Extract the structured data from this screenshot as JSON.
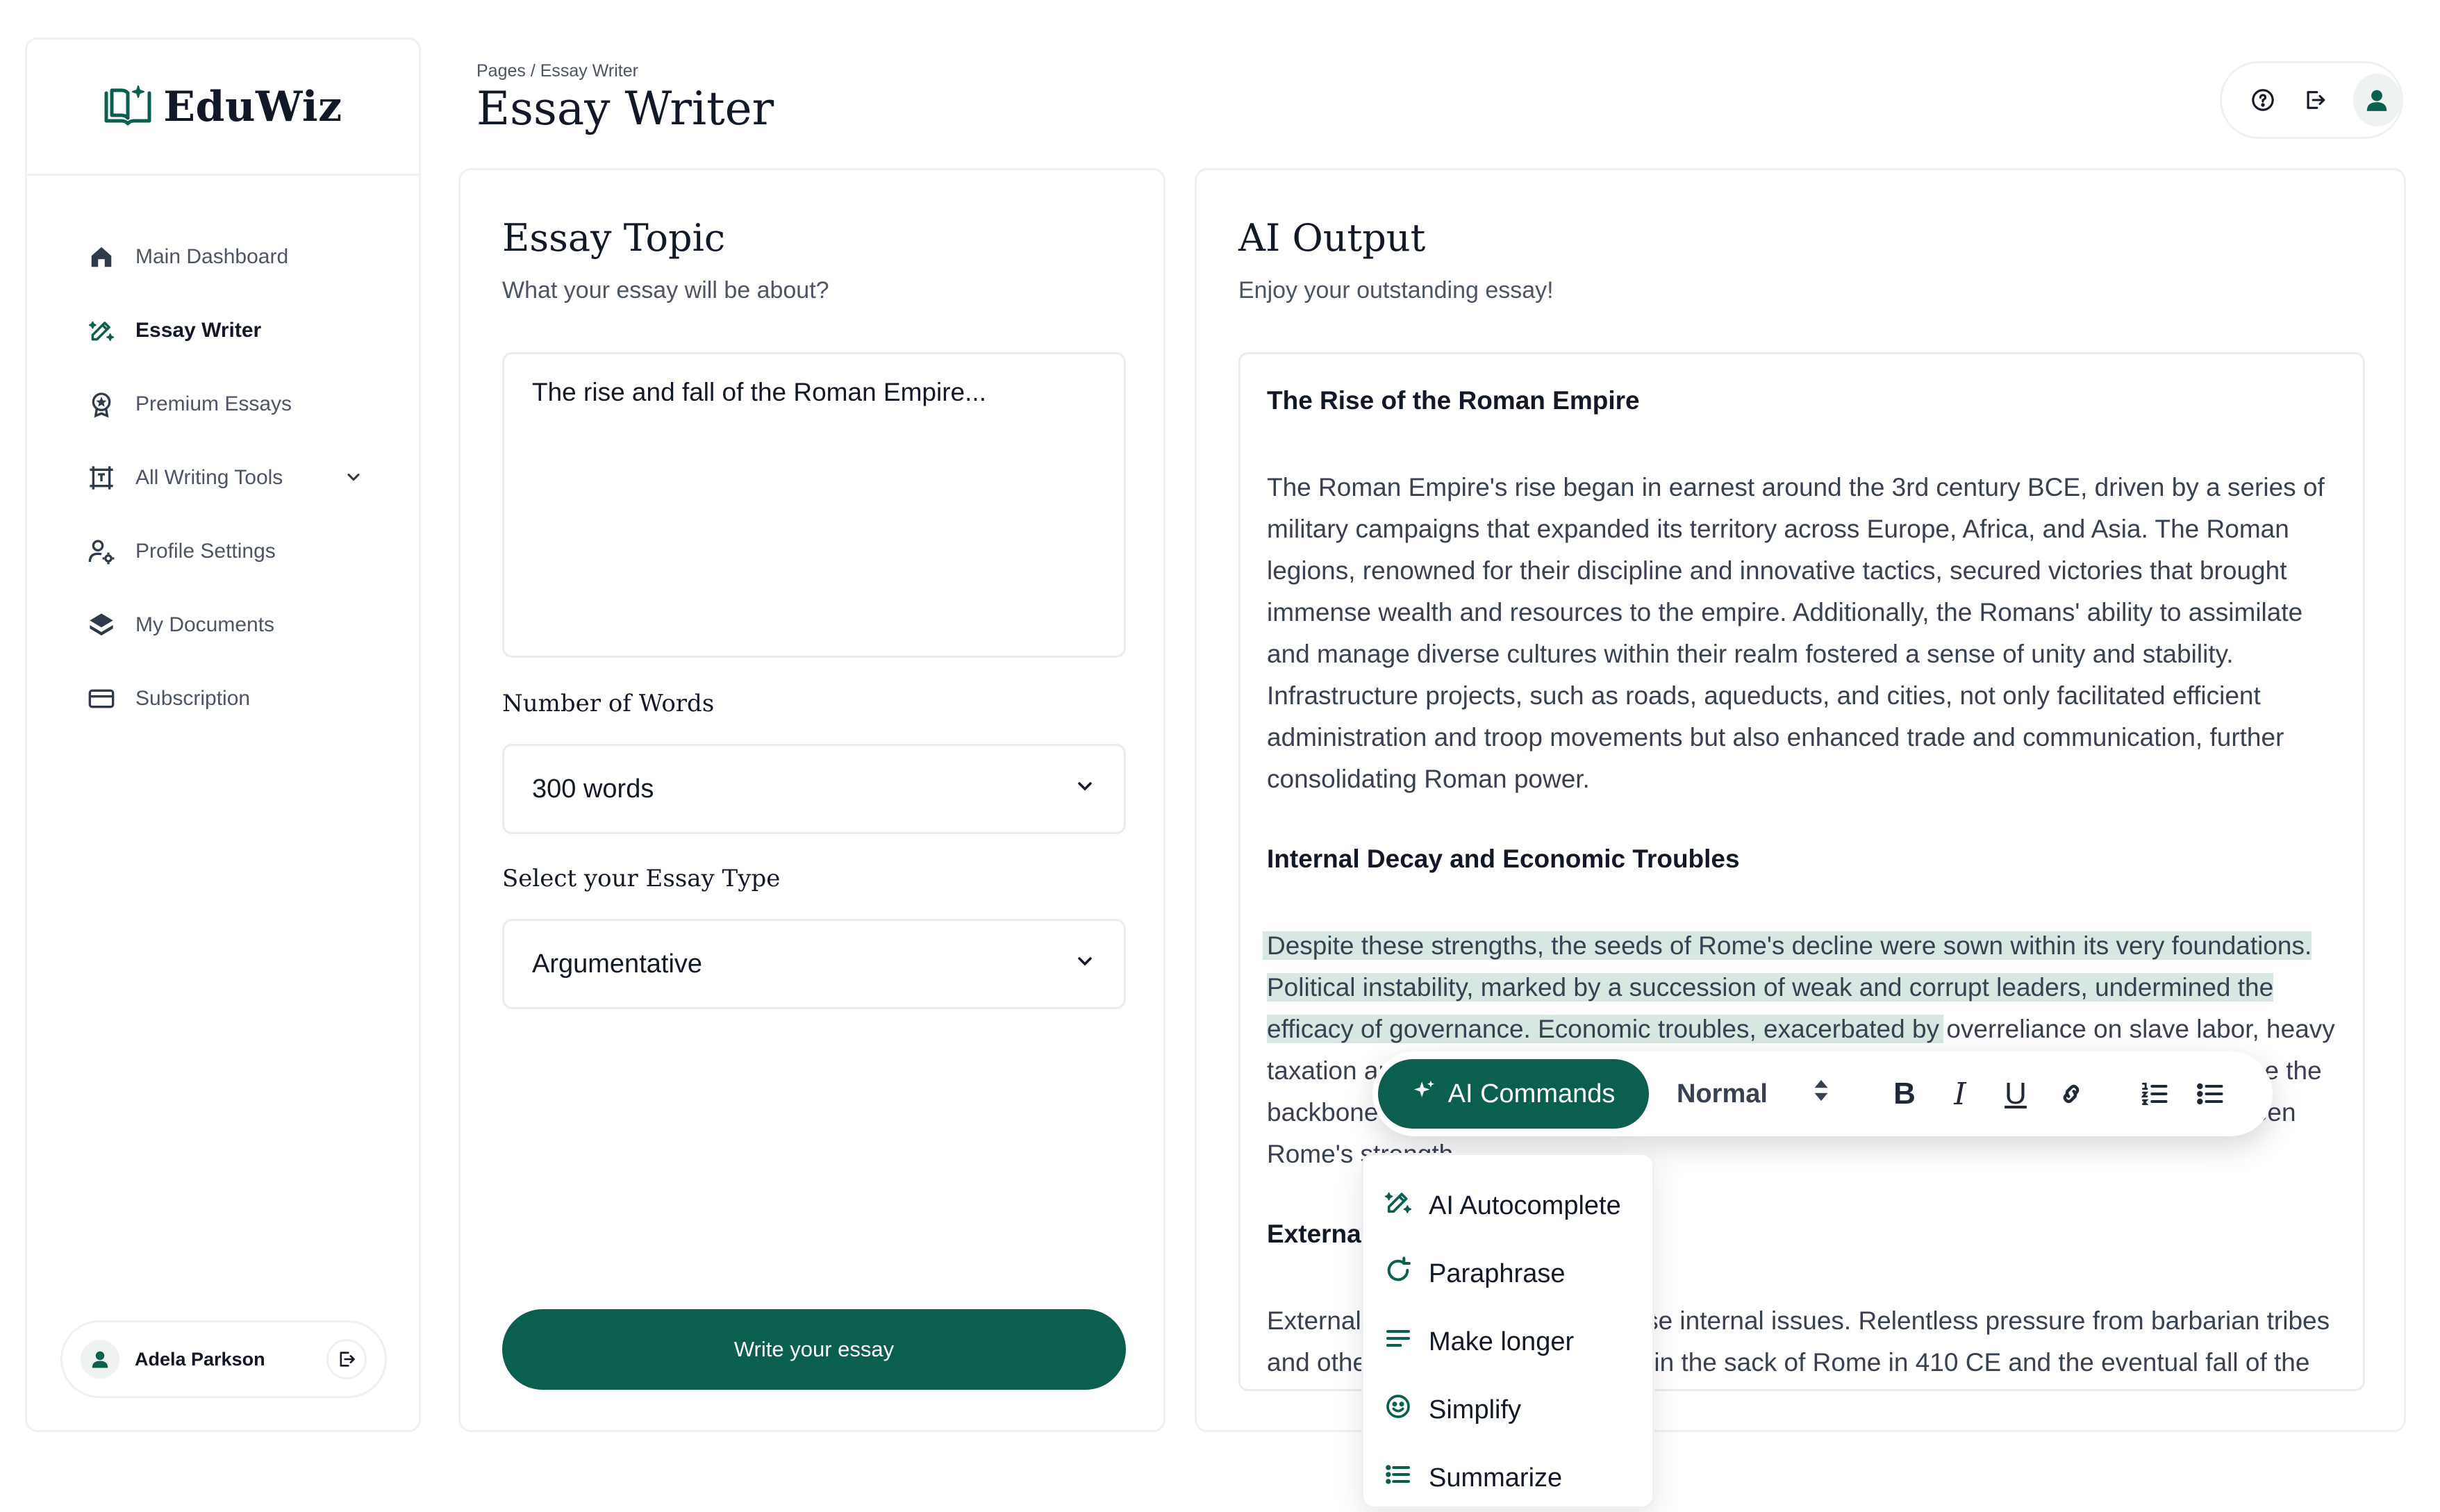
{
  "app": {
    "name": "EduWiz"
  },
  "colors": {
    "brand": "#0b5f4f",
    "highlight": "#d6e8e1",
    "border": "#eef0f2"
  },
  "sidebar": {
    "items": [
      {
        "label": "Main Dashboard",
        "icon": "home-icon"
      },
      {
        "label": "Essay Writer",
        "icon": "pen-sparkle-icon",
        "active": true
      },
      {
        "label": "Premium Essays",
        "icon": "award-icon"
      },
      {
        "label": "All Writing Tools",
        "icon": "frame-icon",
        "has_submenu": true
      },
      {
        "label": "Profile Settings",
        "icon": "user-gear-icon"
      },
      {
        "label": "My Documents",
        "icon": "layers-icon"
      },
      {
        "label": "Subscription",
        "icon": "card-icon"
      }
    ],
    "user": {
      "name": "Adela Parkson"
    }
  },
  "header": {
    "breadcrumb": "Pages / Essay Writer",
    "title": "Essay Writer"
  },
  "topic_panel": {
    "title": "Essay Topic",
    "subtitle": "What your essay will be about?",
    "topic_value": "The rise and fall of the Roman Empire...",
    "words_label": "Number of Words",
    "words_value": "300 words",
    "type_label": "Select your Essay Type",
    "type_value": "Argumentative",
    "submit_label": "Write your essay"
  },
  "output_panel": {
    "title": "AI Output",
    "subtitle": "Enjoy your outstanding essay!",
    "heading1": "The Rise of the Roman Empire",
    "para1": "The Roman Empire's rise began in earnest around the 3rd century BCE, driven by a series of military campaigns that expanded its territory across Europe, Africa, and Asia. The Roman legions, renowned for their discipline and innovative tactics, secured victories that brought immense wealth and resources to the empire. Additionally, the Romans' ability to assimilate and manage diverse cultures within their realm fostered a sense of unity and stability. Infrastructure projects, such as roads, aqueducts, and cities, not only facilitated efficient administration and troop movements but also enhanced trade and communication, further consolidating Roman power.",
    "heading2": "Internal Decay and Economic Troubles",
    "para2_highlighted": "Despite these strengths, the seeds of Rome's decline were sown within its very foundations. Political instability, marked by a succession of weak and corrupt leaders, undermined the efficacy of governance. Economic troubles, exacerbated by",
    "para2_rest": "overreliance on slave labor, heavy taxation and a debasement of currency, strained the empire's finances. The military, once the backbone of Roman expansion, became increasingly mercenary. The army had once been Rome's strength.",
    "heading3": "External Threats and the Fall",
    "para3": "External threats compounded these internal issues. Relentless pressure from barbarian tribes and other adversaries culminated in the sack of Rome in 410 CE and the eventual fall of the Western"
  },
  "toolbar": {
    "ai_commands_label": "AI Commands",
    "style_value": "Normal",
    "bold": "B",
    "italic": "I",
    "underline": "U"
  },
  "ai_menu": {
    "items": [
      {
        "label": "AI Autocomplete",
        "icon": "pen-sparkle-icon"
      },
      {
        "label": "Paraphrase",
        "icon": "refresh-icon"
      },
      {
        "label": "Make longer",
        "icon": "lines-icon"
      },
      {
        "label": "Simplify",
        "icon": "smile-icon"
      },
      {
        "label": "Summarize",
        "icon": "list-icon"
      }
    ]
  }
}
